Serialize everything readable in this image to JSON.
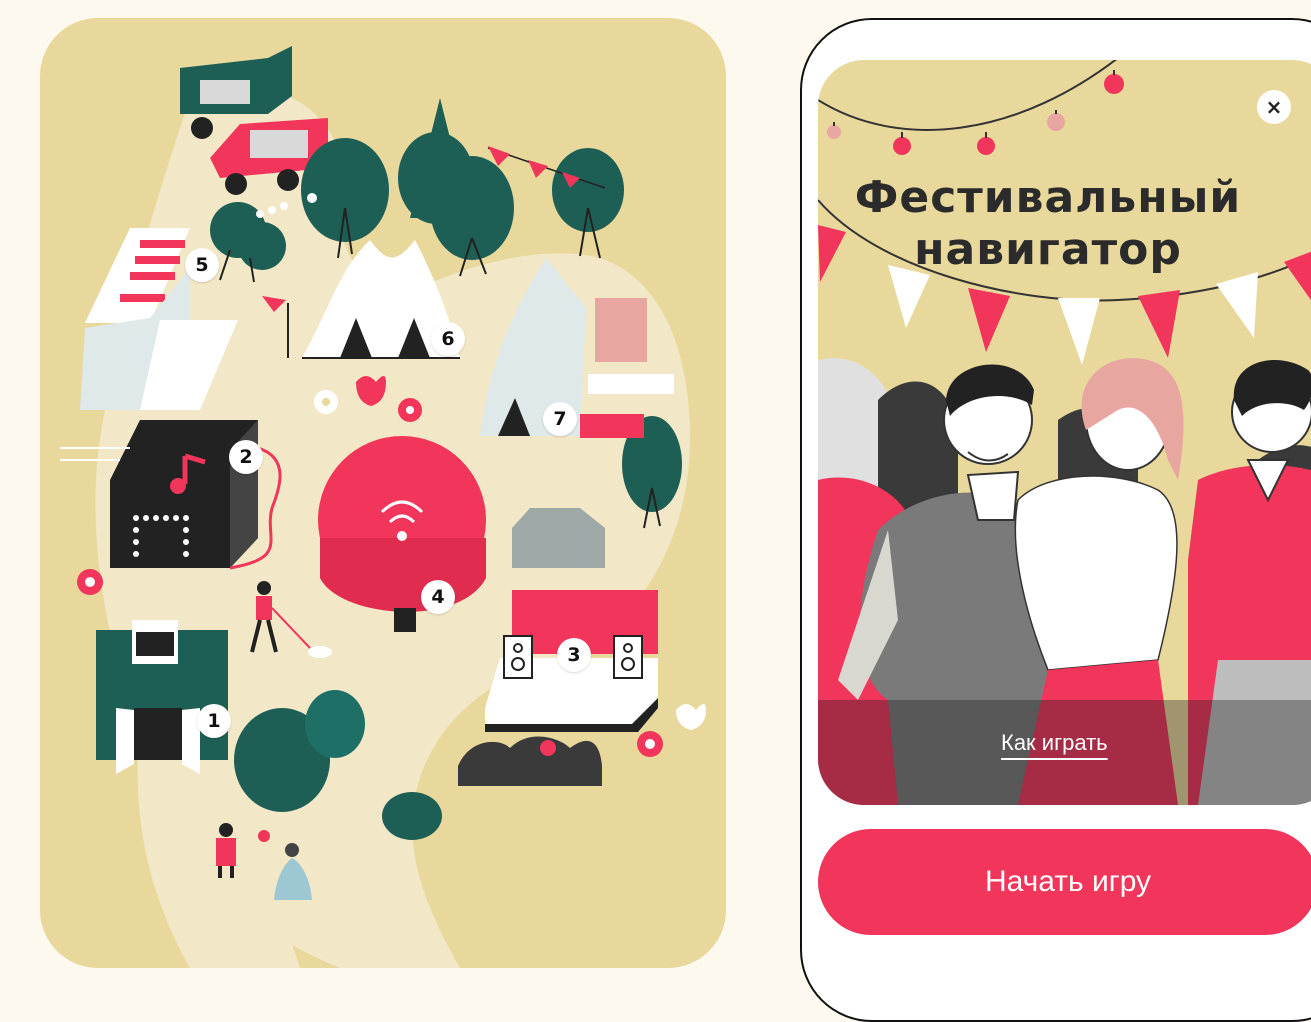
{
  "map": {
    "markers": [
      "1",
      "2",
      "3",
      "4",
      "5",
      "6",
      "7"
    ]
  },
  "screen": {
    "title_line1": "Фестивальный",
    "title_line2": "навигатор",
    "close_icon": "×",
    "how_to_play": "Как играть",
    "start_button": "Начать игру"
  },
  "colors": {
    "accent": "#f2355b",
    "sand": "#e8d89b",
    "dark_green": "#1e5f55",
    "background": "#fdf9ef"
  }
}
